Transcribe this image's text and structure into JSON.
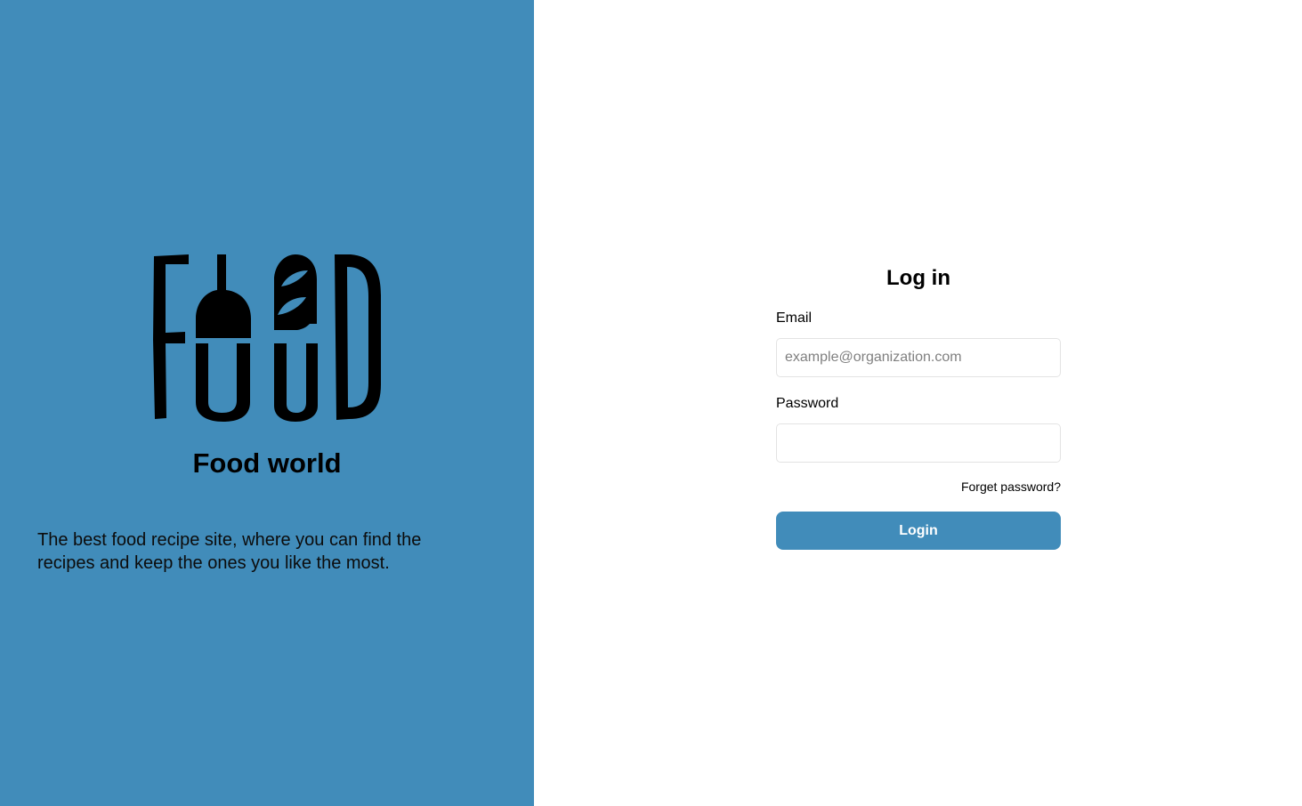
{
  "brand": {
    "logo_text": "FOOD",
    "name": "Food world",
    "tagline": "The best food recipe site, where you can find the recipes and keep the ones you like the most."
  },
  "login": {
    "title": "Log in",
    "email_label": "Email",
    "email_placeholder": "example@organization.com",
    "email_value": "",
    "password_label": "Password",
    "password_value": "",
    "forgot_label": "Forget password?",
    "submit_label": "Login"
  },
  "colors": {
    "accent": "#418cba",
    "text": "#000000",
    "input_border": "#e3e3e3"
  }
}
